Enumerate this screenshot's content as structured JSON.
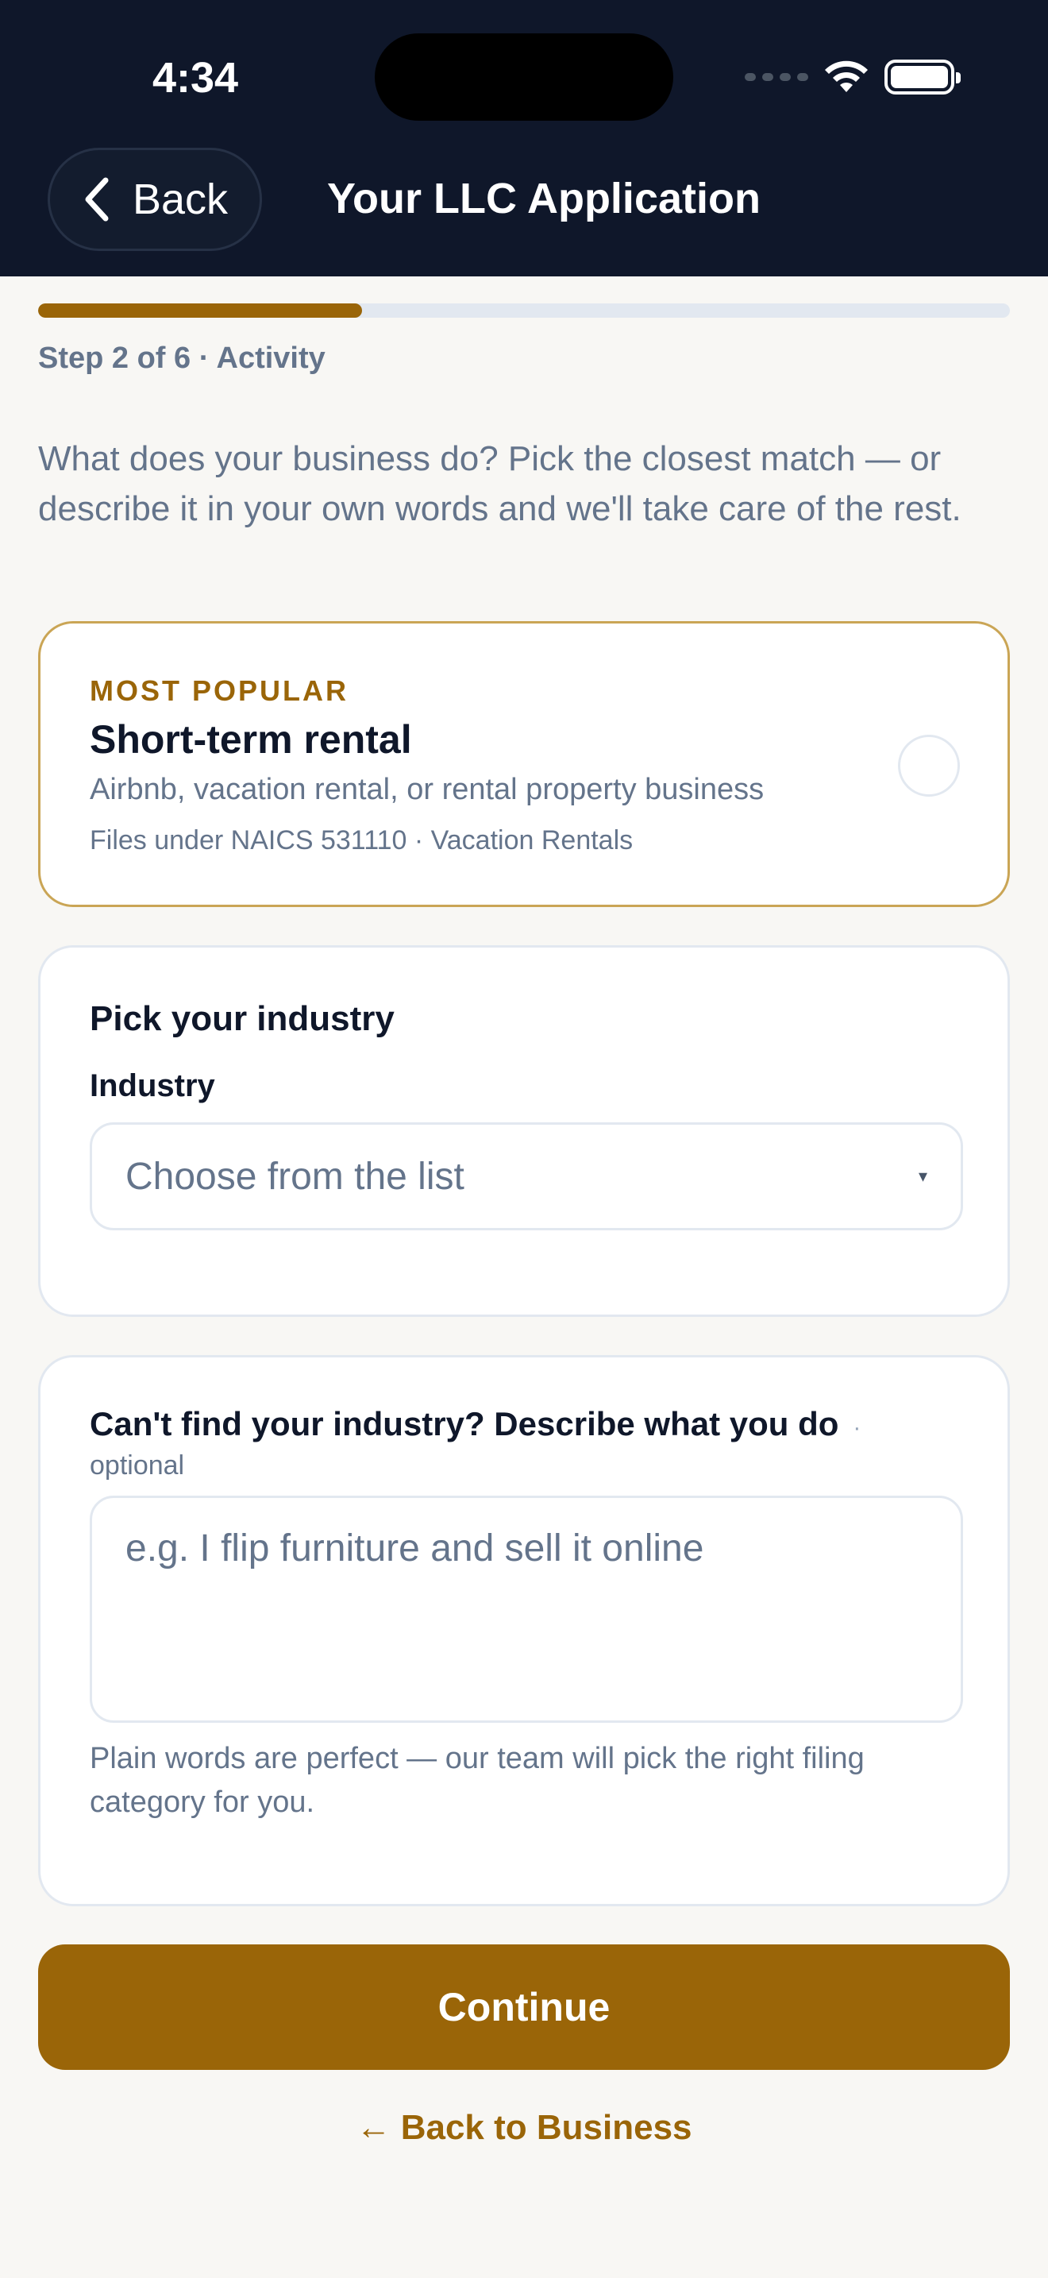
{
  "status_bar": {
    "time": "4:34"
  },
  "header": {
    "back_label": "Back",
    "title": "Your LLC Application"
  },
  "progress": {
    "fraction": 0.333,
    "step_label": "Step 2 of 6 · Activity"
  },
  "intro": "What does your business do? Pick the closest match — or describe it in your own words and we'll take care of the rest.",
  "popular_option": {
    "eyebrow": "MOST POPULAR",
    "title": "Short-term rental",
    "description": "Airbnb, vacation rental, or rental property business",
    "naics": "Files under NAICS 531110 · Vacation Rentals",
    "selected": false
  },
  "industry_card": {
    "title": "Pick your industry",
    "field_label": "Industry",
    "select_placeholder": "Choose from the list",
    "caret": "▾"
  },
  "describe_card": {
    "title": "Can't find your industry? Describe what you do",
    "separator": "·",
    "optional": "optional",
    "placeholder": "e.g. I flip furniture and sell it online",
    "helper": "Plain words are perfect — our team will pick the right filing category for you."
  },
  "actions": {
    "continue_label": "Continue",
    "back_link_label": "← Back to Business"
  },
  "colors": {
    "header_bg": "#0f172a",
    "accent": "#9a6508",
    "page_bg": "#f8f7f4"
  },
  "icons": {
    "back": "chevron-left-icon",
    "wifi": "wifi-icon",
    "battery": "battery-icon",
    "signal": "signal-icon",
    "dropdown": "chevron-down-icon"
  }
}
